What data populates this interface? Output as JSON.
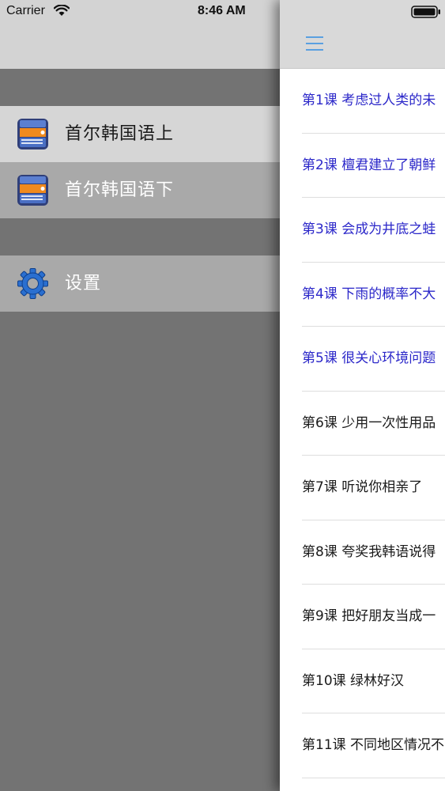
{
  "status_bar": {
    "carrier": "Carrier",
    "time": "8:46 AM"
  },
  "drawer": {
    "items": [
      {
        "label": "首尔韩国语上",
        "icon": "book-icon",
        "selected": true
      },
      {
        "label": "首尔韩国语下",
        "icon": "book-icon",
        "selected": false
      }
    ],
    "settings": {
      "label": "设置",
      "icon": "gear-icon"
    }
  },
  "panel": {
    "menu_icon": "hamburger-menu-icon",
    "lessons": [
      {
        "label": "第1课 考虑过人类的未",
        "read": true
      },
      {
        "label": "第2课 檀君建立了朝鲜",
        "read": true
      },
      {
        "label": "第3课 会成为井底之蛙",
        "read": true
      },
      {
        "label": "第4课 下雨的概率不大",
        "read": true
      },
      {
        "label": "第5课 很关心环境问题",
        "read": true
      },
      {
        "label": "第6课 少用一次性用品",
        "read": false
      },
      {
        "label": "第7课 听说你相亲了",
        "read": false
      },
      {
        "label": "第8课 夸奖我韩语说得",
        "read": false
      },
      {
        "label": "第9课 把好朋友当成一",
        "read": false
      },
      {
        "label": "第10课 绿林好汉",
        "read": false
      },
      {
        "label": "第11课 不同地区情况不",
        "read": false
      }
    ]
  },
  "colors": {
    "accent_blue": "#2b27c9",
    "hamburger_blue": "#5aa0e0",
    "drawer_bg": "#737373",
    "selected_row": "#d6d6d6",
    "unselected_row": "#a9a9a9"
  }
}
